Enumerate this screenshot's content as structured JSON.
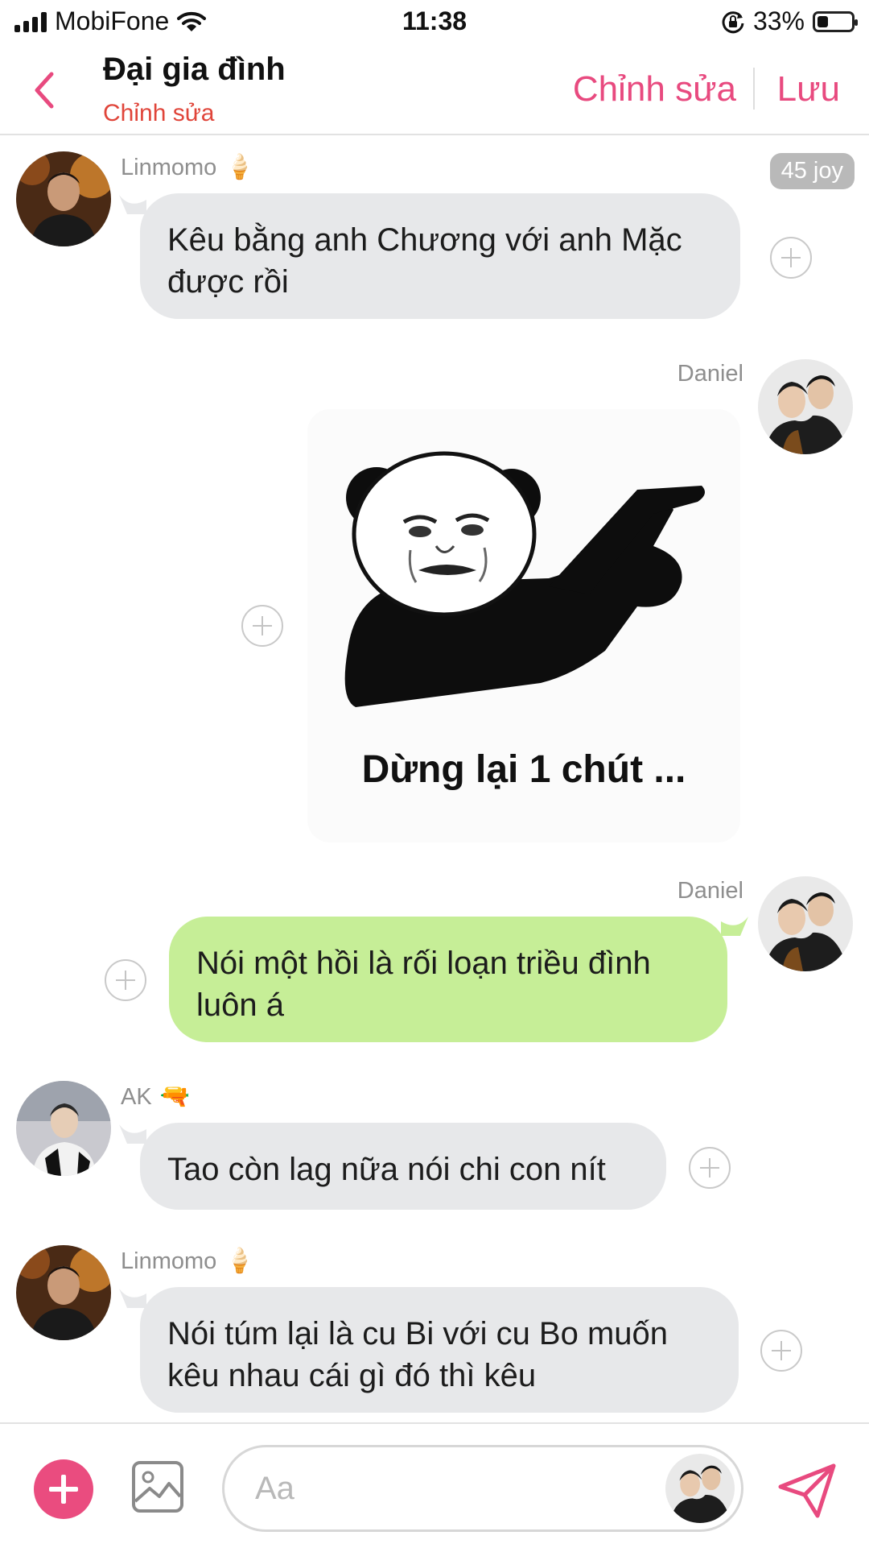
{
  "status_bar": {
    "carrier": "MobiFone",
    "time": "11:38",
    "battery_text": "33%",
    "battery_level": 0.33,
    "icons": [
      "signal-icon",
      "wifi-icon",
      "rotation-lock-icon",
      "battery-icon"
    ]
  },
  "header": {
    "title": "Đại gia đình",
    "subtitle": "Chỉnh sửa",
    "edit_label": "Chỉnh sửa",
    "save_label": "Lưu",
    "accent_color": "#e84a7f",
    "subtitle_color": "#e0453a"
  },
  "messages": [
    {
      "sender": "Linmomo",
      "sender_emoji": "🍦",
      "text": "Kêu bằng anh Chương với anh Mặc được rồi",
      "side": "left",
      "badge": "45 joy"
    },
    {
      "sender": "Daniel",
      "type": "sticker",
      "sticker_caption": "Dừng lại 1 chút ...",
      "side": "right"
    },
    {
      "sender": "Daniel",
      "text": "Nói một hồi là rối loạn triều đình luôn á",
      "side": "right"
    },
    {
      "sender": "AK",
      "sender_emoji": "🔫",
      "text": "Tao còn lag nữa nói chi con nít",
      "side": "left"
    },
    {
      "sender": "Linmomo",
      "sender_emoji": "🍦",
      "text": "Nói túm lại là cu Bi với cu Bo muốn kêu nhau cái gì đó thì kêu",
      "side": "left"
    }
  ],
  "composer": {
    "placeholder": "Aa"
  },
  "colors": {
    "bubble_gray": "#e7e8ea",
    "bubble_green": "#c6ee97",
    "add_button": "#ea4c7f"
  }
}
